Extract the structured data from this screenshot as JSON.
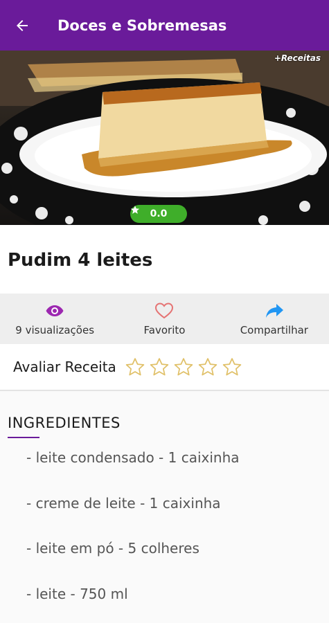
{
  "appbar": {
    "title": "Doces e Sobremesas",
    "back_icon": "arrow-left-icon",
    "background": "#6a1b9a"
  },
  "hero": {
    "watermark": "+Receitas",
    "rating": "0.0",
    "rating_icon": "star-icon",
    "rating_color": "#3fae2a"
  },
  "recipe": {
    "title": "Pudim 4 leites"
  },
  "actions": [
    {
      "icon": "eye-icon",
      "label": "9 visualizações",
      "color": "#9c27b0"
    },
    {
      "icon": "heart-outline-icon",
      "label": "Favorito",
      "color": "#e57373"
    },
    {
      "icon": "share-arrow-icon",
      "label": "Compartilhar",
      "color": "#2196f3"
    }
  ],
  "rating_row": {
    "label": "Avaliar Receita",
    "stars_total": 5,
    "stars_filled": 0,
    "star_color": "#e0c068"
  },
  "ingredients": {
    "heading": "INGREDIENTES",
    "items": [
      "- leite condensado - 1 caixinha",
      "- creme de leite - 1 caixinha",
      "- leite em pó - 5 colheres",
      "- leite - 750 ml"
    ]
  }
}
